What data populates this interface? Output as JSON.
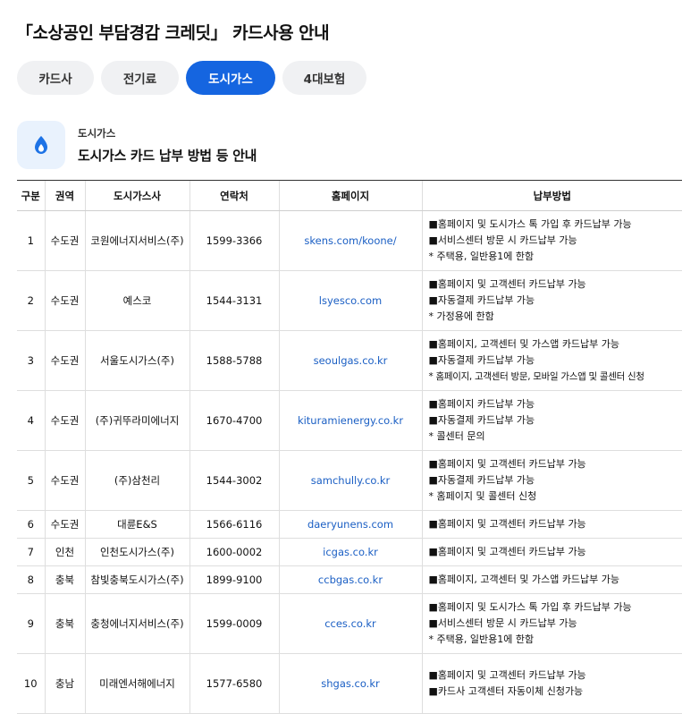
{
  "page": {
    "title": "「소상공인 부담경감 크레딧」 카드사용 안내"
  },
  "tabs": [
    {
      "label": "카드사",
      "active": false
    },
    {
      "label": "전기료",
      "active": false
    },
    {
      "label": "도시가스",
      "active": true
    },
    {
      "label": "4대보험",
      "active": false
    }
  ],
  "section": {
    "icon": "flame-icon",
    "category": "도시가스",
    "title": "도시가스 카드 납부 방법 등 안내"
  },
  "table": {
    "headers": [
      "구분",
      "권역",
      "도시가스사",
      "연락처",
      "홈페이지",
      "납부방법"
    ],
    "rows": [
      {
        "no": "1",
        "region": "수도권",
        "company": "코원에너지서비스(주)",
        "phone": "1599-3366",
        "homepage": "skens.com/koone/",
        "methods": [
          "■홈페이지 및 도시가스 톡 가입 후 카드납부 가능",
          "■서비스센터 방문 시 카드납부 가능",
          "* 주택용, 일반용1에 한함"
        ]
      },
      {
        "no": "2",
        "region": "수도권",
        "company": "예스코",
        "phone": "1544-3131",
        "homepage": "lsyesco.com",
        "methods": [
          "■홈페이지 및 고객센터 카드납부 가능",
          "■자동결제 카드납부 가능",
          "* 가정용에 한함"
        ]
      },
      {
        "no": "3",
        "region": "수도권",
        "company": "서울도시가스(주)",
        "phone": "1588-5788",
        "homepage": "seoulgas.co.kr",
        "methods": [
          "■홈페이지, 고객센터 및 가스앱 카드납부 가능",
          "■자동결제 카드납부 가능",
          "* 홈페이지, 고객센터 방문, 모바일 가스앱 및 콜센터 신청"
        ]
      },
      {
        "no": "4",
        "region": "수도권",
        "company": "(주)귀뚜라미에너지",
        "phone": "1670-4700",
        "homepage": "kituramienergy.co.kr",
        "methods": [
          "■홈페이지 카드납부 가능",
          "■자동결제 카드납부 가능",
          "* 콜센터 문의"
        ]
      },
      {
        "no": "5",
        "region": "수도권",
        "company": "(주)삼천리",
        "phone": "1544-3002",
        "homepage": "samchully.co.kr",
        "methods": [
          "■홈페이지 및 고객센터 카드납부 가능",
          "■자동결제 카드납부 가능",
          "* 홈페이지 및 콜센터 신청"
        ]
      },
      {
        "no": "6",
        "region": "수도권",
        "company": "대륜E&S",
        "phone": "1566-6116",
        "homepage": "daeryunens.com",
        "methods": [
          "■홈페이지 및 고객센터 카드납부 가능"
        ]
      },
      {
        "no": "7",
        "region": "인천",
        "company": "인천도시가스(주)",
        "phone": "1600-0002",
        "homepage": "icgas.co.kr",
        "methods": [
          "■홈페이지 및 고객센터 카드납부 가능"
        ]
      },
      {
        "no": "8",
        "region": "충북",
        "company": "참빛충북도시가스(주)",
        "phone": "1899-9100",
        "homepage": "ccbgas.co.kr",
        "methods": [
          "■홈페이지, 고객센터 및 가스앱 카드납부 가능"
        ]
      },
      {
        "no": "9",
        "region": "충북",
        "company": "충청에너지서비스(주)",
        "phone": "1599-0009",
        "homepage": "cces.co.kr",
        "methods": [
          "■홈페이지 및 도시가스 톡 가입 후 카드납부 가능",
          "■서비스센터 방문 시 카드납부 가능",
          "* 주택용, 일반용1에 한함"
        ]
      },
      {
        "no": "10",
        "region": "충남",
        "company": "미래엔서해에너지",
        "phone": "1577-6580",
        "homepage": "shgas.co.kr",
        "methods": [
          "■홈페이지 및 고객센터 카드납부 가능",
          "■카드사 고객센터 자동이체 신청가능"
        ]
      }
    ]
  },
  "colors": {
    "accent": "#1565e0",
    "link": "#1b5fc4",
    "icon_bg": "#e9f2fd"
  }
}
